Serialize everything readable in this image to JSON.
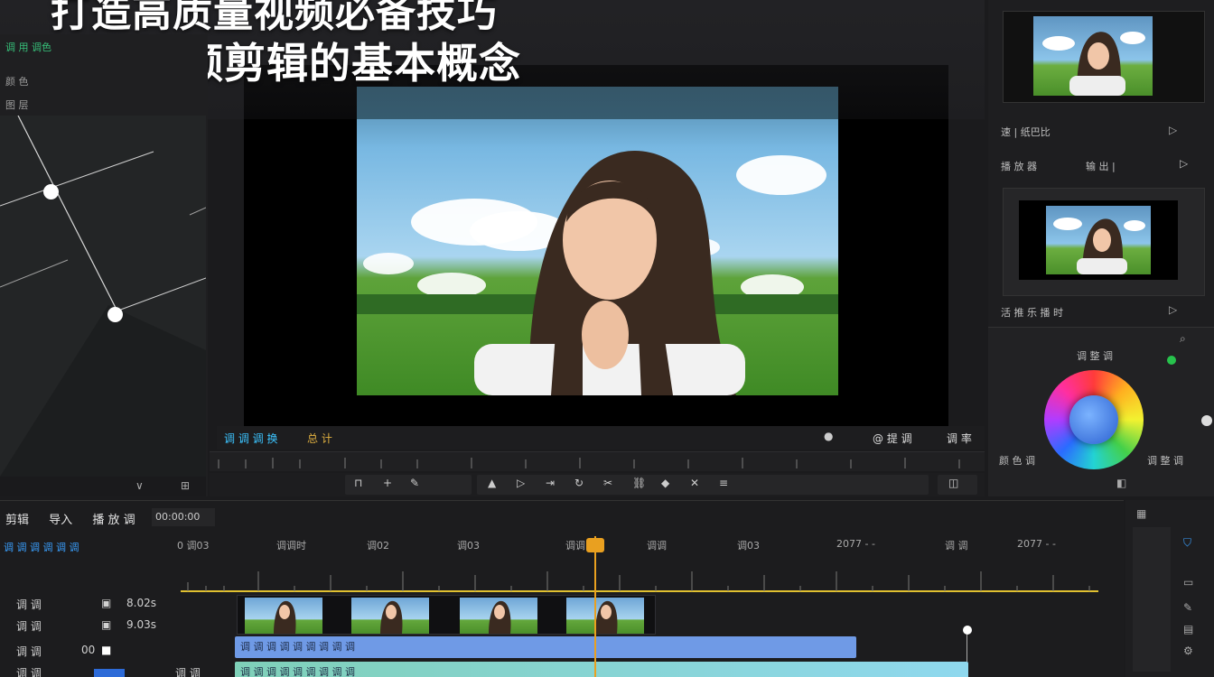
{
  "title": {
    "line1": "打造高质量视频必备技巧",
    "line2": "了解视频剪辑的基本概念"
  },
  "left_panel": {
    "header": "调 用 调色",
    "rows": [
      "颜 色",
      "图 层"
    ]
  },
  "monitor": {
    "bar_left_1": "调 调 调 换",
    "bar_left_2": "总 计",
    "bar_right_1": "@ 提 调",
    "bar_right_2": "调 率"
  },
  "right_panel": {
    "label1": "速 | 纸巴比",
    "label2_left": "播 放 器",
    "label2_right": "输 出 |",
    "label3": "活 推 乐 播 时",
    "color_title": "调 整 调",
    "color_left": "颜 色 调",
    "color_right": "调 整 调"
  },
  "timeline": {
    "tabs": [
      "剪辑",
      "导入",
      "播 放 调"
    ],
    "timecode": "00:00:00",
    "sub_label": "调 调 调 调 调 调",
    "markers": [
      "0 调03",
      "调调时",
      "调02",
      "调03",
      "调调",
      "调调",
      "调03",
      "2077 - -",
      "调 调",
      "2077 - -"
    ],
    "tracks": [
      {
        "name": "调 调",
        "value": "8.02s"
      },
      {
        "name": "调 调",
        "value": "9.03s"
      },
      {
        "name": "调 调",
        "value": "00"
      },
      {
        "name": "调 调",
        "value": "调 调"
      }
    ],
    "audio1": "调 调 调 调  调 调 调 调 调",
    "audio2": "调 调 调 调  调 调 调 调 调"
  },
  "colors": {
    "accent": "#e9a020",
    "audio_clip": "#6f9ae6",
    "audio_clip2": "#7fd0b8"
  }
}
